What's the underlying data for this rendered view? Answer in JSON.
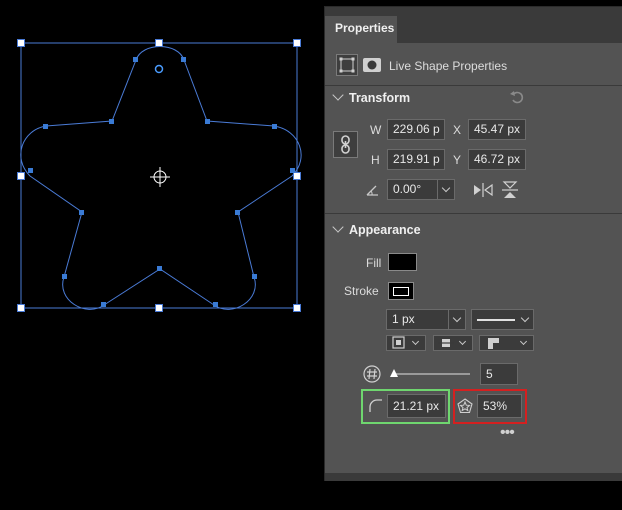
{
  "panel": {
    "tab_label": "Properties",
    "shape_type_label": "Live Shape Properties"
  },
  "transform": {
    "title": "Transform",
    "w_label": "W",
    "w_value": "229.06 p",
    "x_label": "X",
    "x_value": "45.47 px",
    "h_label": "H",
    "h_value": "219.91 p",
    "y_label": "Y",
    "y_value": "46.72 px",
    "angle_value": "0.00°"
  },
  "appearance": {
    "title": "Appearance",
    "fill_label": "Fill",
    "fill_color": "#000000",
    "stroke_label": "Stroke",
    "stroke_width": "1 px",
    "star_points": "5",
    "corner_radius": "21.21 px",
    "star_indent": "53%"
  },
  "colors": {
    "path": "#4a7bd6",
    "handle": "#3a7bd5",
    "highlight_green": "#6fd66f",
    "highlight_red": "#d42020"
  }
}
